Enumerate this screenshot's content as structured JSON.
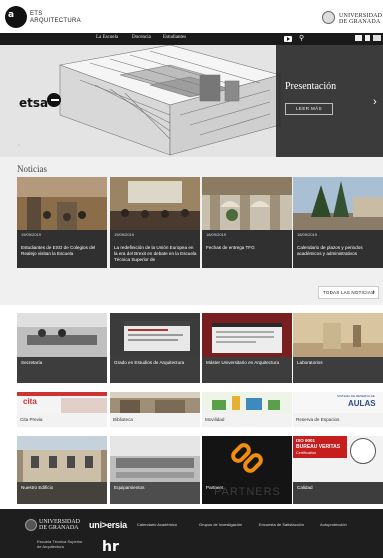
{
  "header": {
    "logo_mark": "a",
    "ets_line1": "ETS",
    "ets_line2": "ARQUITECTURA",
    "ugr_line1": "UNIVERSIDAD",
    "ugr_line2": "DE GRANADA"
  },
  "nav": {
    "items": [
      "La Escuela",
      "Docencia",
      "Estudiantes"
    ],
    "icons": [
      "youtube-icon",
      "search-icon",
      "mail-icon",
      "document-icon",
      "users-icon"
    ]
  },
  "hero": {
    "logo_text": "etsa",
    "title": "Presentación",
    "button": "LEER MÁS",
    "prev": "‹",
    "next": "›"
  },
  "news": {
    "heading": "Noticias",
    "items": [
      {
        "date": "19/09/2019",
        "title": "Estudiantes de ESO de Colegios del Realejo visitan la Escuela"
      },
      {
        "date": "19/09/2019",
        "title": "La redefinición de la Unión Europea en la era del Brexit en debate en la Escuela Técnica Superior de"
      },
      {
        "date": "18/09/2019",
        "title": "Fechas de entrega TFG"
      },
      {
        "date": "18/09/2019",
        "title": "Calendario de plazos y periodos académicos y administrativos"
      }
    ],
    "all_button": "TODAS LAS NOTICIAS",
    "all_chevron": "›"
  },
  "sections": [
    {
      "label": "Secretaría"
    },
    {
      "label": "Grado en Estudios de Arquitectura"
    },
    {
      "label": "Máster Universitario en Arquitectura"
    },
    {
      "label": "Laboratorios"
    }
  ],
  "services": [
    {
      "label": "Cita Previa"
    },
    {
      "label": "Biblioteca"
    },
    {
      "label": "Movilidad"
    },
    {
      "label": "Reserva de Espacios"
    }
  ],
  "services_banner": {
    "aulas": "AULAS",
    "reserva_small": "SISTEMA DE RESERVA DE",
    "cita_logo": "cita"
  },
  "info": [
    {
      "label": "Nuestro Edificio"
    },
    {
      "label": "Equipamientos"
    },
    {
      "label": "Partners"
    },
    {
      "label": "Calidad"
    }
  ],
  "info_extra": {
    "partners_word": "PARTNERS",
    "iso": "ISO 9001",
    "bv1": "BUREAU VERITAS",
    "bv2": "Certification"
  },
  "footer": {
    "ugr_line1": "UNIVERSIDAD",
    "ugr_line2": "DE GRANADA",
    "sub_line1": "Escuela Técnica Superior",
    "sub_line2": "de Arquitectura",
    "universia": "uni>ersia",
    "links": [
      "Calendario Académico",
      "Grupos de Investigación",
      "Encuesta de Satisfacción",
      "Autoprotección"
    ],
    "hr_logo": "hr"
  },
  "colors": {
    "dark": "#1a1a1a",
    "panel": "#232323",
    "caption": "#3d3d3d",
    "partners_orange": "#f28c0f"
  }
}
